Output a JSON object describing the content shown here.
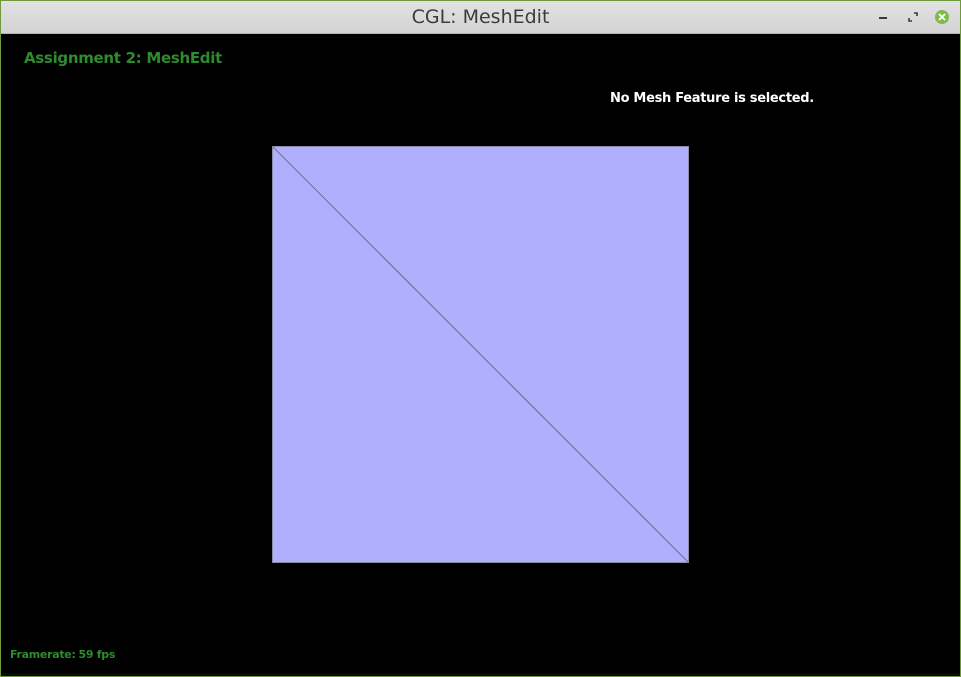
{
  "window": {
    "title": "CGL: MeshEdit",
    "controls": {
      "minimize_icon": "minimize-icon",
      "maximize_icon": "maximize-icon",
      "close_icon": "close-icon",
      "close_color": "#7fba4a"
    }
  },
  "viewport": {
    "assignment_title": "Assignment 2: MeshEdit",
    "selection_status": "No Mesh Feature is selected.",
    "framerate_label": "Framerate:",
    "framerate_value": "59 fps",
    "mesh": {
      "fill_color": "#afaffe",
      "edge_color": "#5c5c78",
      "shape": "quad split into two triangles by diagonal"
    },
    "text_color_green": "#2e8b2e",
    "background_color": "#000000"
  }
}
